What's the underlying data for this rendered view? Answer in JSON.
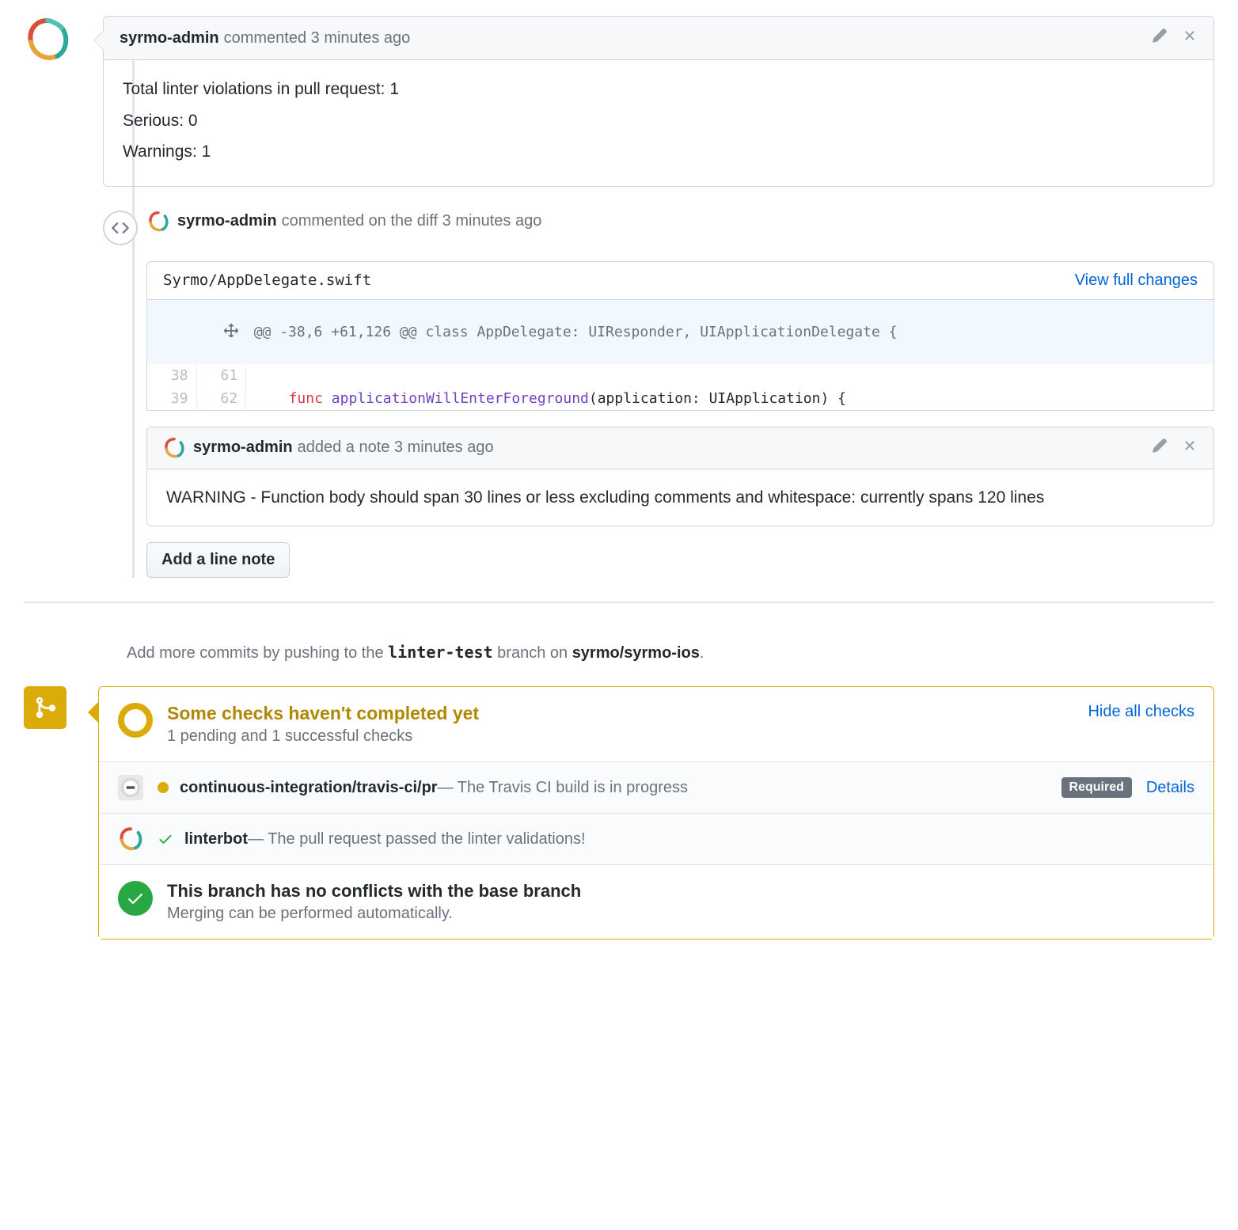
{
  "comment1": {
    "author": "syrmo-admin",
    "meta": "commented 3 minutes ago",
    "lines": [
      "Total linter violations in pull request: 1",
      "Serious: 0",
      "Warnings: 1"
    ]
  },
  "diff_event": {
    "author": "syrmo-admin",
    "meta": "commented on the diff 3 minutes ago"
  },
  "file": {
    "path": "Syrmo/AppDelegate.swift",
    "view_full": "View full changes",
    "hunk": "@@ -38,6 +61,126 @@ class AppDelegate: UIResponder, UIApplicationDelegate {",
    "rows": [
      {
        "old": "38",
        "new": "61",
        "code": ""
      },
      {
        "old": "39",
        "new": "62",
        "code_prefix": "    ",
        "kw1": "func",
        "kw2": "applicationWillEnterForeground",
        "rest": "(application: UIApplication) {"
      }
    ]
  },
  "note": {
    "author": "syrmo-admin",
    "meta": "added a note 3 minutes ago",
    "body": "WARNING - Function body should span 30 lines or less excluding comments and whitespace: currently spans 120 lines"
  },
  "add_note_btn": "Add a line note",
  "push_hint": {
    "prefix": "Add more commits by pushing to the ",
    "branch": "linter-test",
    "mid": " branch on ",
    "repo": "syrmo/syrmo-ios",
    "suffix": "."
  },
  "merge": {
    "title": "Some checks haven't completed yet",
    "sub": "1 pending and 1 successful checks",
    "hide": "Hide all checks",
    "checks": [
      {
        "avatar": "travis",
        "status": "pending",
        "name": "continuous-integration/travis-ci/pr",
        "desc": " — The Travis CI build is in progress",
        "required": "Required",
        "details": "Details"
      },
      {
        "avatar": "swirl",
        "status": "success",
        "name": "linterbot",
        "desc": " — The pull request passed the linter validations!"
      }
    ],
    "conflict_title": "This branch has no conflicts with the base branch",
    "conflict_sub": "Merging can be performed automatically."
  }
}
